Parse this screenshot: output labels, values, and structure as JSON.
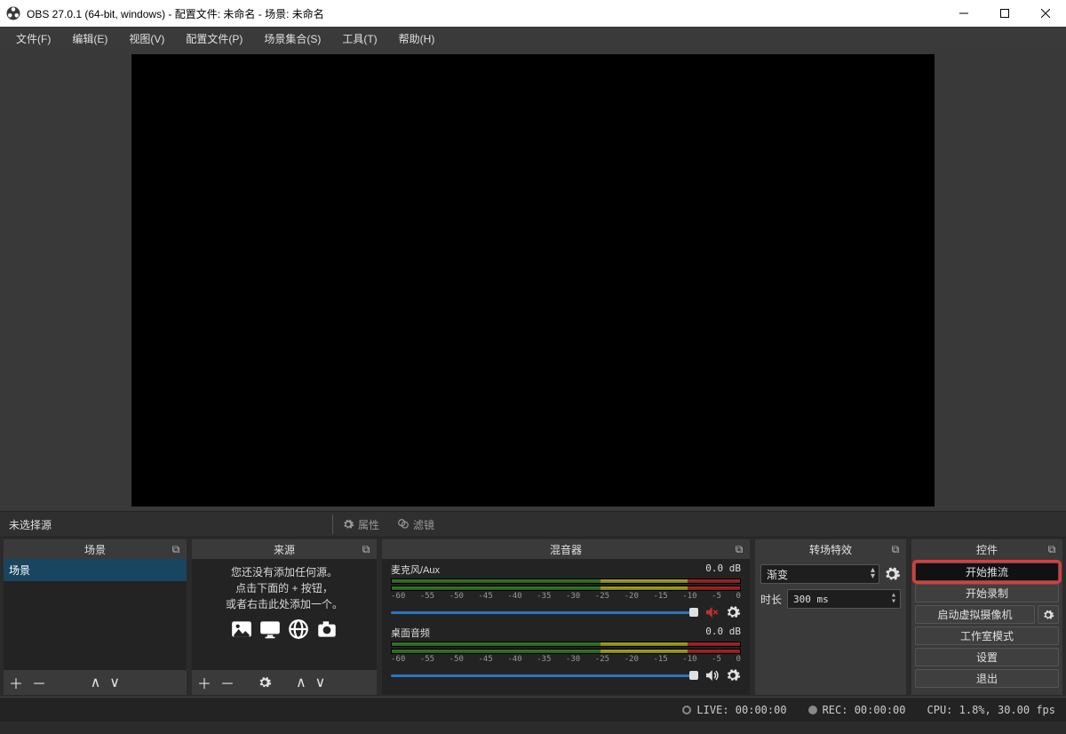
{
  "titlebar": {
    "title": "OBS 27.0.1 (64-bit, windows) - 配置文件: 未命名 - 场景: 未命名"
  },
  "menu": {
    "file": "文件(F)",
    "edit": "编辑(E)",
    "view": "视图(V)",
    "profile": "配置文件(P)",
    "scene_collection": "场景集合(S)",
    "tools": "工具(T)",
    "help": "帮助(H)"
  },
  "srcbar": {
    "no_selection": "未选择源",
    "properties": "属性",
    "filters": "滤镜"
  },
  "panels": {
    "scenes": {
      "title": "场景",
      "items": [
        "场景"
      ]
    },
    "sources": {
      "title": "来源",
      "hint_l1": "您还没有添加任何源。",
      "hint_l2": "点击下面的 + 按钮，",
      "hint_l3": "或者右击此处添加一个。"
    },
    "mixer": {
      "title": "混音器",
      "mic": {
        "name": "麦克风/Aux",
        "db": "0.0 dB"
      },
      "desktop": {
        "name": "桌面音频",
        "db": "0.0 dB"
      },
      "ticks": [
        "-60",
        "-55",
        "-50",
        "-45",
        "-40",
        "-35",
        "-30",
        "-25",
        "-20",
        "-15",
        "-10",
        "-5",
        "0"
      ]
    },
    "transitions": {
      "title": "转场特效",
      "selected": "渐变",
      "duration_label": "时长",
      "duration_value": "300 ms"
    },
    "controls": {
      "title": "控件",
      "start_stream": "开始推流",
      "start_record": "开始录制",
      "start_vcam": "启动虚拟摄像机",
      "studio_mode": "工作室模式",
      "settings": "设置",
      "exit": "退出"
    }
  },
  "status": {
    "live": "LIVE: 00:00:00",
    "rec": "REC: 00:00:00",
    "cpu": "CPU: 1.8%, 30.00 fps"
  }
}
